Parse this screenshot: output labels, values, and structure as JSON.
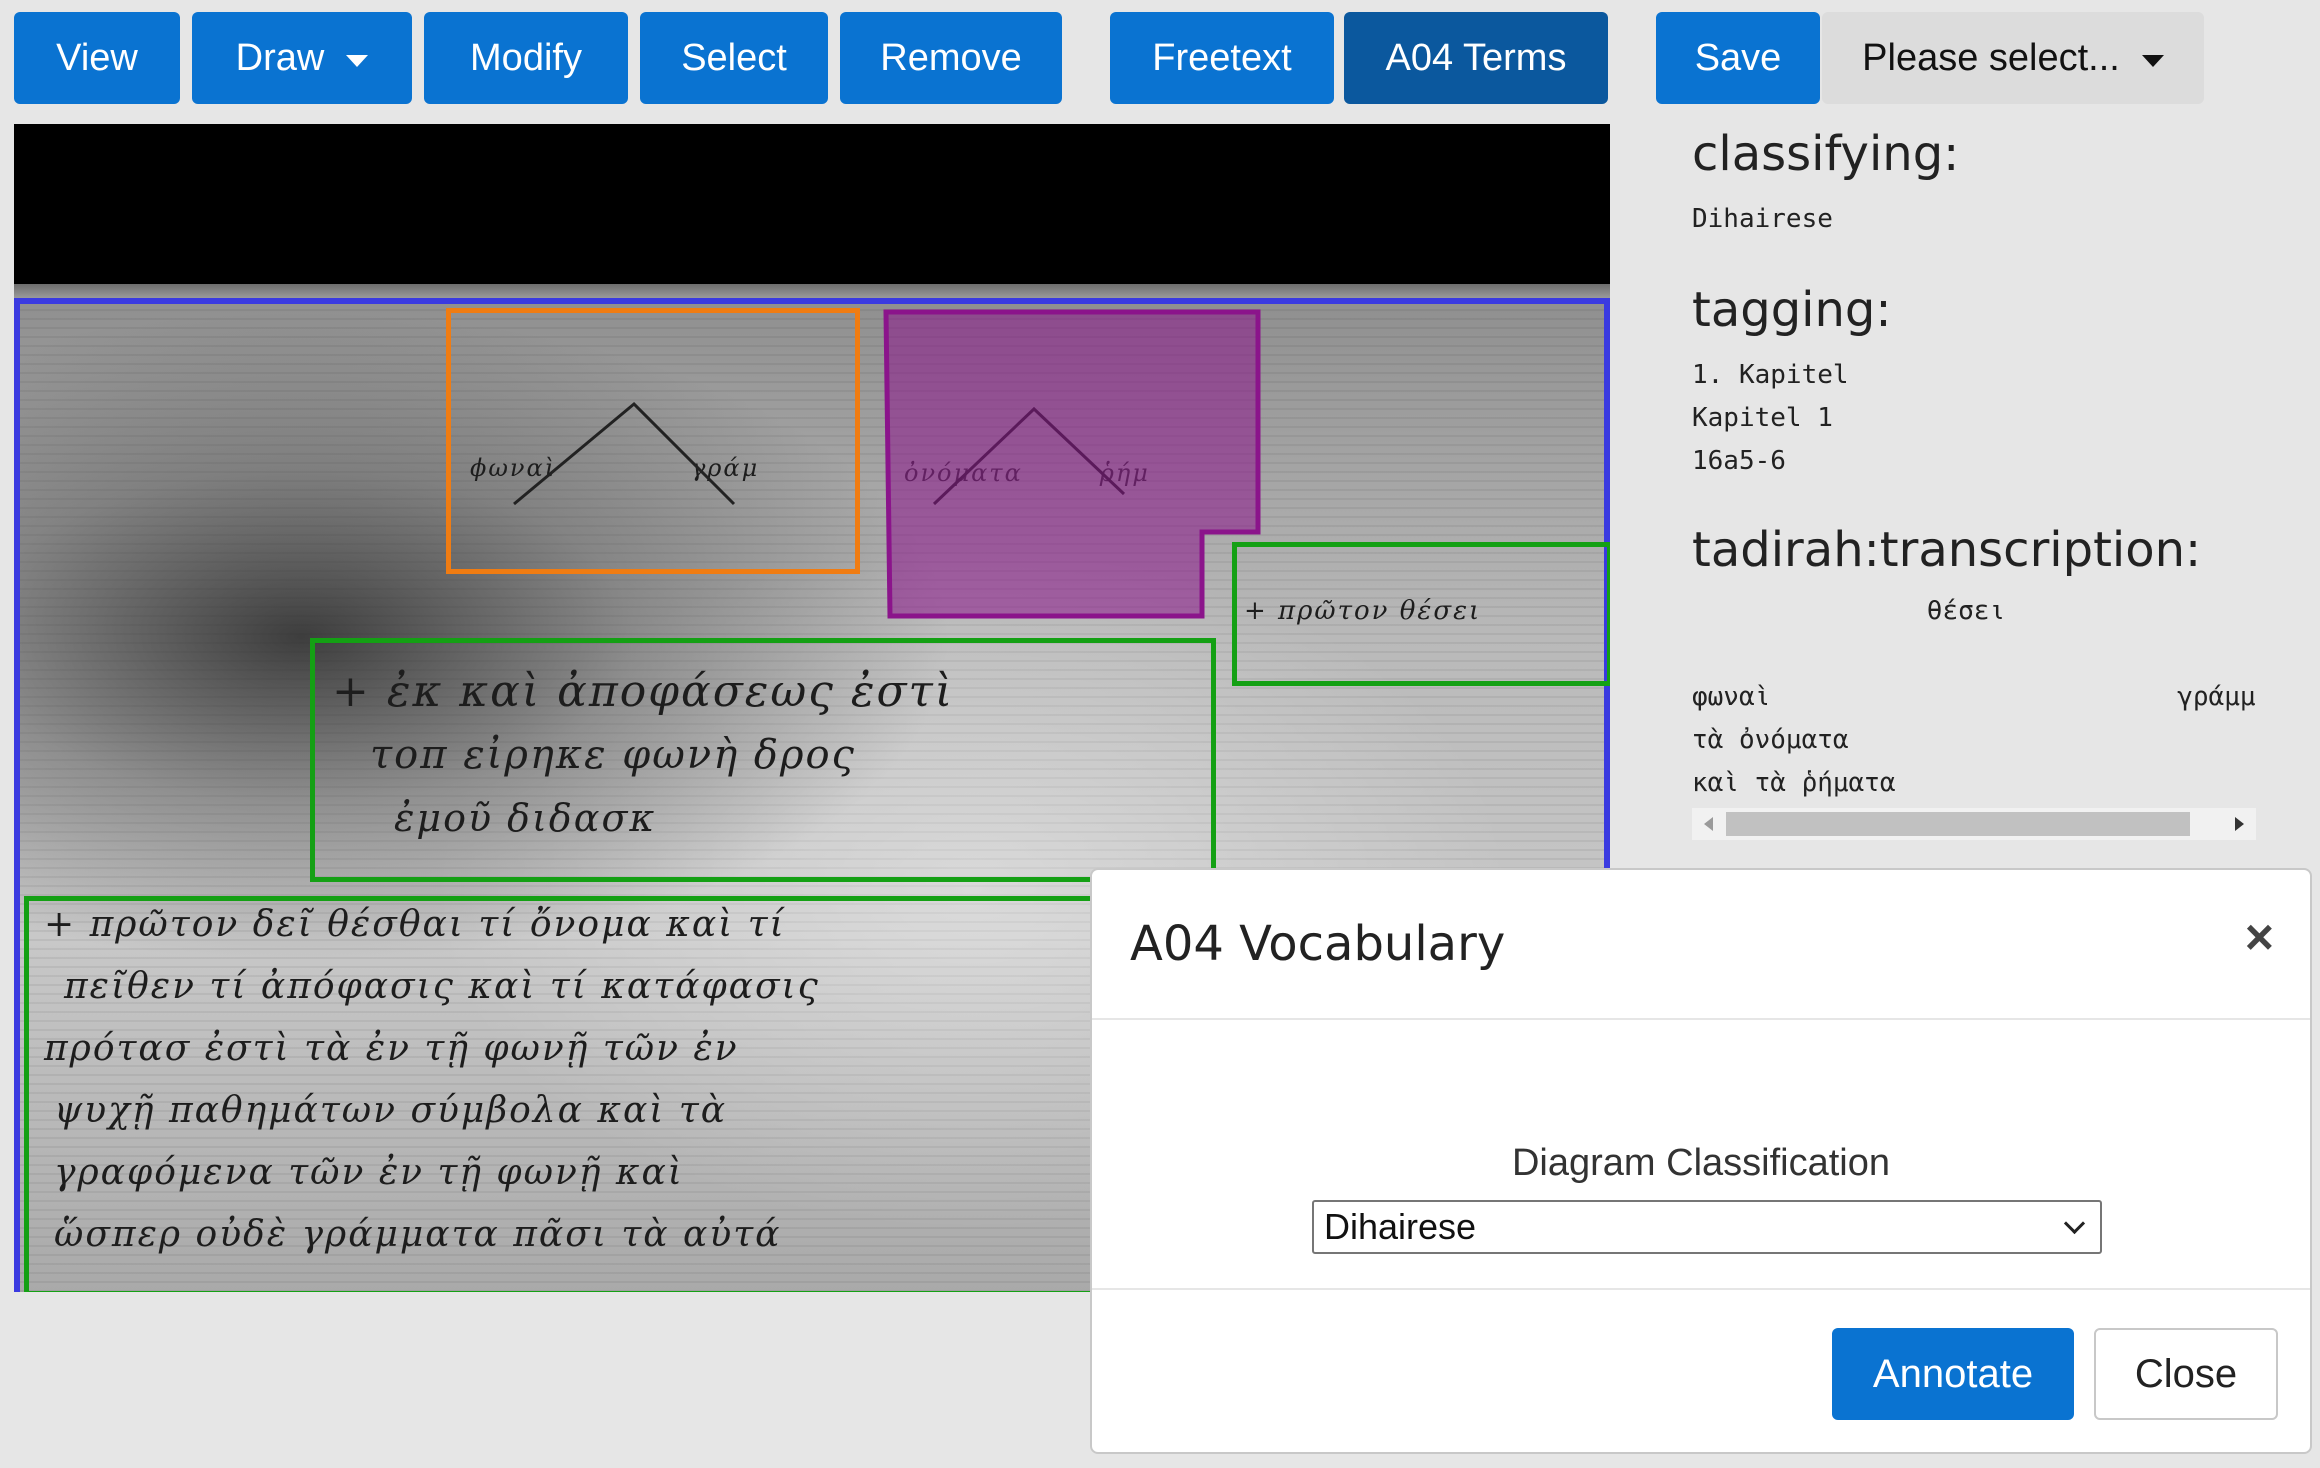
{
  "toolbar": {
    "view": "View",
    "draw": "Draw",
    "modify": "Modify",
    "select": "Select",
    "remove": "Remove",
    "freetext": "Freetext",
    "a04_terms": "A04 Terms",
    "save": "Save",
    "please_select": "Please select..."
  },
  "colors": {
    "primary": "#0a73d1",
    "primary_active": "#0b589e",
    "annotation_blue": "#3a3ae0",
    "annotation_orange": "#f07c12",
    "annotation_purple": "#8b148b",
    "annotation_green": "#14a014"
  },
  "panel": {
    "classifying_heading": "classifying:",
    "classifying_value": "Dihairese",
    "tagging_heading": "tagging:",
    "tagging_values": [
      "1. Kapitel",
      "Kapitel 1",
      "16a5-6"
    ],
    "transcription_heading": "tadirah:transcription:",
    "transcription_lines": [
      "               θέσει",
      "",
      "φωναὶ                          γράμμ",
      "τὰ ὀνόματα",
      "καὶ τὰ ῥήματα"
    ]
  },
  "modal": {
    "title": "A04 Vocabulary",
    "close_icon": "×",
    "field_label": "Diagram Classification",
    "selected_option": "Dihairese",
    "annotate_label": "Annotate",
    "close_label": "Close"
  }
}
